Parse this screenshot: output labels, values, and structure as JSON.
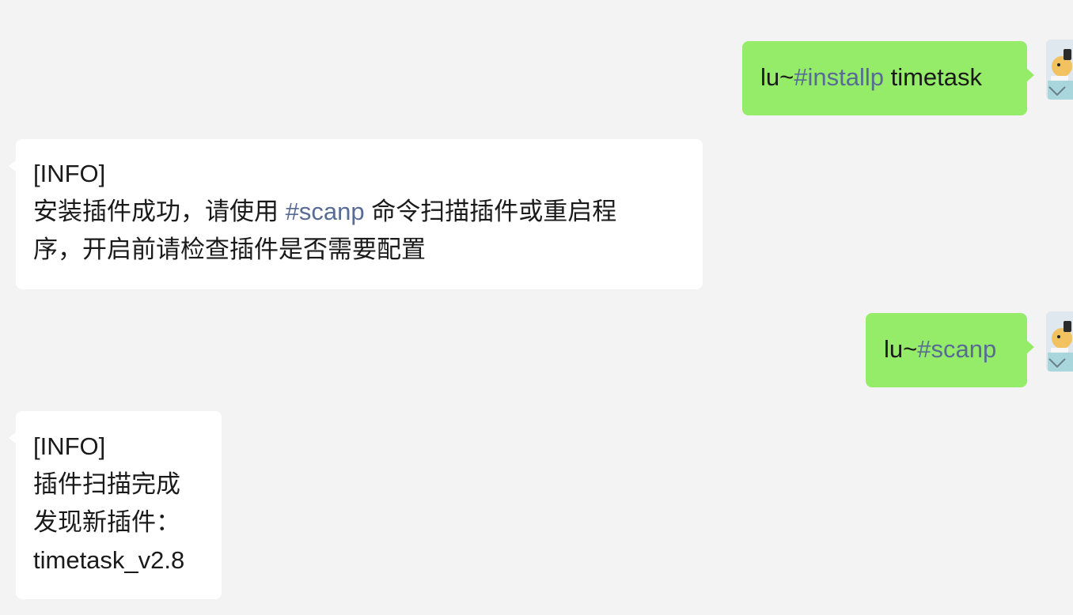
{
  "messages": [
    {
      "direction": "out",
      "prefix": "lu~",
      "tag": "#installp",
      "suffix": " timetask"
    },
    {
      "direction": "in",
      "line1": "[INFO]",
      "line2_before": "安装插件成功，请使用 ",
      "line2_tag": "#scanp",
      "line2_after": " 命令扫描插件或重启程",
      "line3": "序，开启前请检查插件是否需要配置"
    },
    {
      "direction": "out",
      "prefix": "lu~",
      "tag": "#scanp"
    },
    {
      "direction": "in",
      "lines": [
        "[INFO]",
        "插件扫描完成",
        "发现新插件：",
        "timetask_v2.8"
      ]
    }
  ],
  "colors": {
    "background": "#f3f3f3",
    "outgoing_bubble": "#95ec69",
    "incoming_bubble": "#ffffff",
    "hashtag": "#576b95",
    "text": "#1a1a1a"
  },
  "icons": {
    "avatar": "user-avatar-illustration"
  }
}
